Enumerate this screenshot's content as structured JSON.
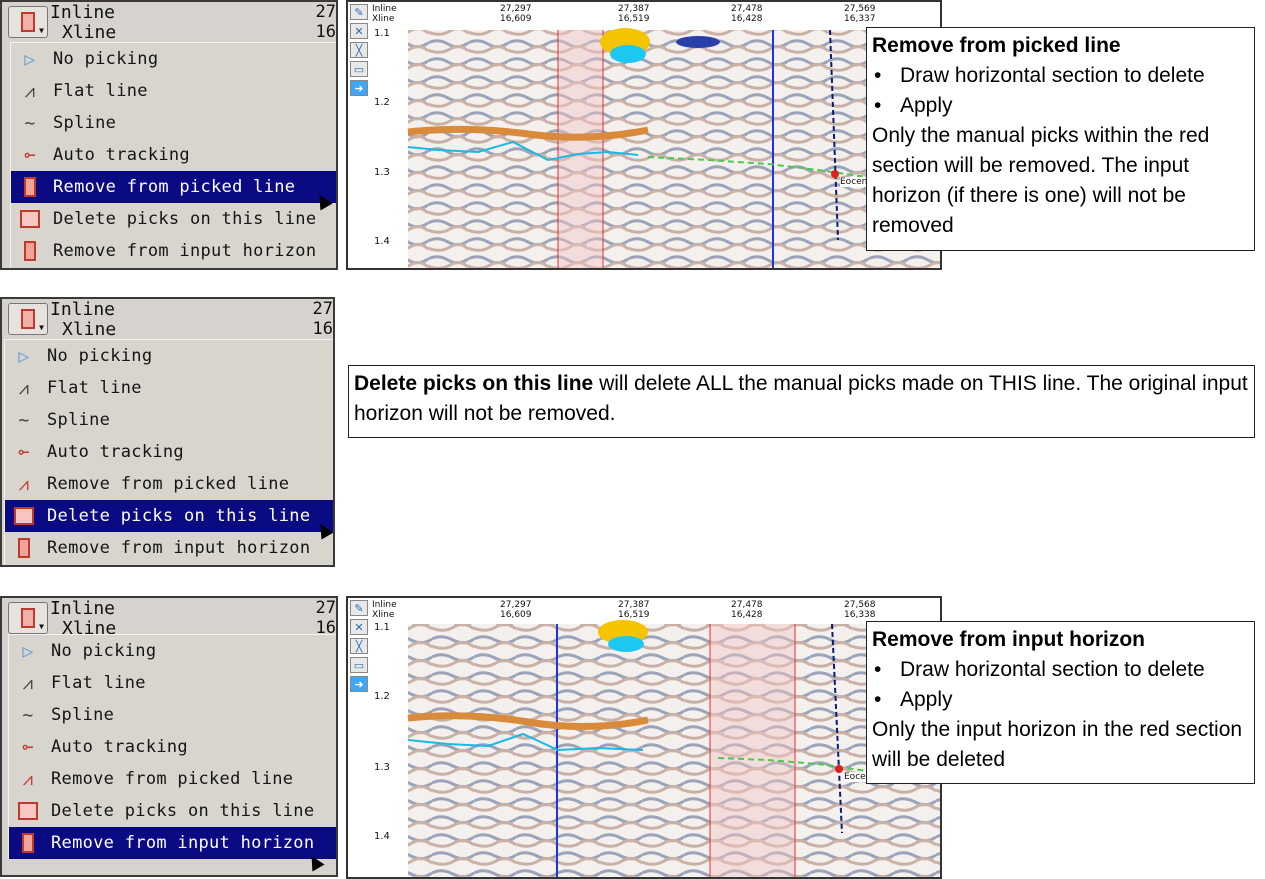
{
  "menu_common": {
    "inline": "Inline",
    "xline": "Xline",
    "coord_a": "27",
    "coord_b": "16"
  },
  "menu_items": [
    "No picking",
    "Flat line",
    "Spline",
    "Auto tracking",
    "Remove from picked line",
    "Delete picks on this line",
    "Remove from input horizon"
  ],
  "panels": [
    {
      "selected_index": 4
    },
    {
      "selected_index": 5
    },
    {
      "selected_index": 6
    }
  ],
  "seismic_top": {
    "inline_hdr": "Inline",
    "xline_hdr": "Xline",
    "columns": [
      [
        "27,297",
        "16,609"
      ],
      [
        "27,387",
        "16,519"
      ],
      [
        "27,478",
        "16,428"
      ],
      [
        "27,569",
        "16,337"
      ]
    ],
    "ticks": [
      "1.1",
      "1.2",
      "1.3",
      "1.4"
    ],
    "horizon_label": "Eocen"
  },
  "seismic_bottom": {
    "inline_hdr": "Inline",
    "xline_hdr": "Xline",
    "columns": [
      [
        "27,297",
        "16,609"
      ],
      [
        "27,387",
        "16,519"
      ],
      [
        "27,478",
        "16,428"
      ],
      [
        "27,568",
        "16,338"
      ]
    ],
    "ticks": [
      "1.1",
      "1.2",
      "1.3",
      "1.4"
    ],
    "horizon_label": "Eocen"
  },
  "notes": {
    "remove_picked": {
      "title": "Remove from picked line",
      "bullets": [
        "Draw horizontal section to delete",
        "Apply"
      ],
      "body": "Only the manual picks within the red section will be removed. The input horizon (if there is one) will not be removed"
    },
    "delete_picks": {
      "bold": "Delete picks on this line",
      "body": " will delete ALL the manual picks made on THIS line. The original input horizon will not be removed."
    },
    "remove_input": {
      "title": "Remove from input horizon",
      "bullets": [
        "Draw horizontal section to delete",
        "Apply"
      ],
      "body": "Only the input horizon in the red section will be deleted"
    }
  }
}
